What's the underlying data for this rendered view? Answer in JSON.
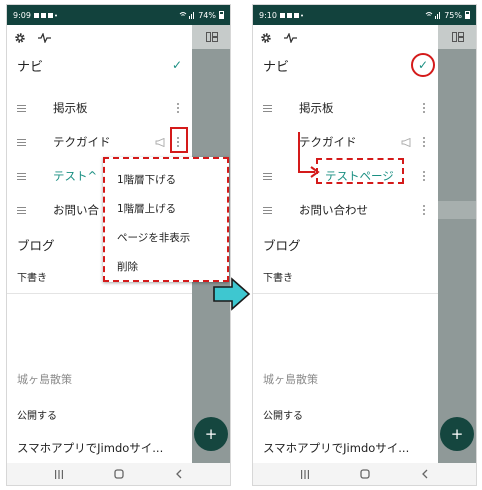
{
  "left": {
    "status": {
      "time": "9:09",
      "battery": "74%"
    },
    "nav": {
      "title": "ナビ",
      "items": [
        {
          "label": "掲示板"
        },
        {
          "label": "テクガイド"
        },
        {
          "label": "テスト^"
        },
        {
          "label": "お問い合"
        }
      ]
    },
    "blog": {
      "title": "ブログ",
      "draft": "下書き"
    },
    "second_blog": {
      "title": "城ヶ島散策",
      "publish": "公開する",
      "post": "スマホアプリでJimdoサイ..."
    },
    "context_menu": {
      "items": [
        {
          "label": "1階層下げる"
        },
        {
          "label": "1階層上げる"
        },
        {
          "label": "ページを非表示"
        },
        {
          "label": "削除"
        }
      ]
    }
  },
  "right": {
    "status": {
      "time": "9:10",
      "battery": "75%"
    },
    "nav": {
      "title": "ナビ",
      "items": [
        {
          "label": "掲示板"
        },
        {
          "label": "テクガイド"
        },
        {
          "label": "テストページ"
        },
        {
          "label": "お問い合わせ"
        }
      ]
    },
    "blog": {
      "title": "ブログ",
      "draft": "下書き"
    },
    "second_blog": {
      "title": "城ヶ島散策",
      "publish": "公開する",
      "post": "スマホアプリでJimdoサイ..."
    }
  },
  "colors": {
    "status_bar": "#12423d",
    "accent": "#1a8f82",
    "highlight": "#d41a1a",
    "transition_arrow": "#3ec7d0"
  },
  "icons": [
    "gear-icon",
    "activity-icon",
    "check-icon",
    "drag-handle-icon",
    "more-vert-icon",
    "megaphone-icon",
    "plus-icon",
    "recents-icon",
    "home-icon",
    "back-icon"
  ]
}
